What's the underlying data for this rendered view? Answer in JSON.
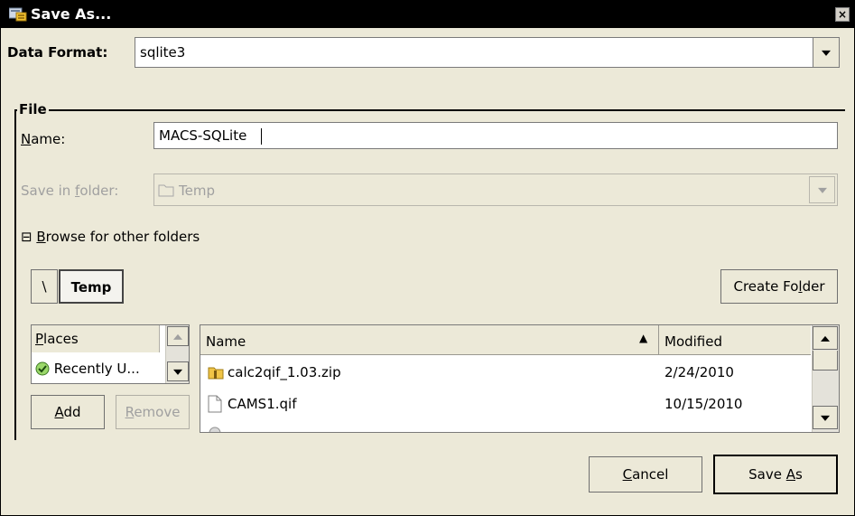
{
  "window": {
    "title": "Save As...",
    "close_glyph": "×",
    "icon": "save-dialog-icon"
  },
  "data_format": {
    "label_prefix": "Data Format",
    "label_suffix": ":",
    "value": "sqlite3"
  },
  "file_group": {
    "title": "File",
    "name_label_mnemonic": "N",
    "name_label_rest": "ame:",
    "name_value": "MACS-SQLite",
    "save_in_label_pre": "Save in ",
    "save_in_label_mnemonic": "f",
    "save_in_label_post": "older:",
    "save_in_value": "Temp",
    "browse_expander": "⊟",
    "browse_mnemonic": "B",
    "browse_rest": "rowse for other folders"
  },
  "path_bar": {
    "root": "\\",
    "current": "Temp"
  },
  "create_folder": {
    "pre": "Create Fo",
    "mnemonic": "l",
    "post": "der"
  },
  "places": {
    "header_mnemonic": "P",
    "header_rest": "laces",
    "items": [
      "Recently U..."
    ],
    "add_mnemonic": "A",
    "add_rest": "dd",
    "remove_mnemonic": "R",
    "remove_rest": "emove"
  },
  "files": {
    "columns": {
      "name": "Name",
      "modified": "Modified"
    },
    "sort_indicator": "▲",
    "rows": [
      {
        "name": "calc2qif_1.03.zip",
        "modified": "2/24/2010",
        "icon": "zip-folder-icon"
      },
      {
        "name": "CAMS1.qif",
        "modified": "10/15/2010",
        "icon": "document-icon"
      }
    ]
  },
  "actions": {
    "cancel_mnemonic": "C",
    "cancel_rest": "ancel",
    "save_pre": "Save ",
    "save_mnemonic": "A",
    "save_post": "s"
  },
  "colors": {
    "dialog_bg": "#ece9d8",
    "titlebar_bg": "#000000",
    "field_bg": "#ffffff",
    "disabled_text": "#a0a0a0"
  }
}
